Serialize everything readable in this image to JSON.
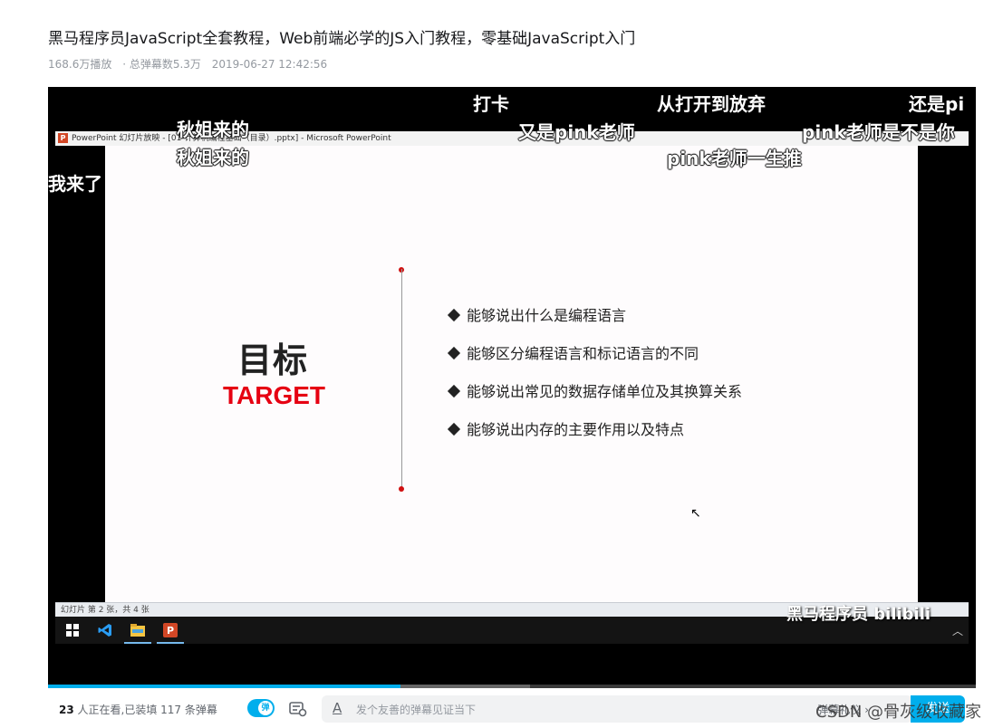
{
  "video": {
    "title": "黑马程序员JavaScript全套教程，Web前端必学的JS入门教程，零基础JavaScript入门",
    "plays": "168.6万播放",
    "danmaku_total": "· 总弹幕数5.3万",
    "date": "2019-06-27 12:42:56"
  },
  "ppt": {
    "window_title": "PowerPoint 幻灯片放映 - [01-计算机编程基础（目录）.pptx] - Microsoft PowerPoint",
    "app_icon": "P",
    "status": "幻灯片 第 2 张，共 4 张",
    "slide": {
      "heading": "目标",
      "subheading": "TARGET",
      "bullets": [
        "能够说出什么是编程语言",
        "能够区分编程语言和标记语言的不同",
        "能够说出常见的数据存储单位及其换算关系",
        "能够说出内存的主要作用以及特点"
      ]
    }
  },
  "danmaku": [
    "打卡",
    "从打开到放弃",
    "还是pi",
    "秋姐来的",
    "秋姐来的",
    "又是pink老师",
    "pink老师是不是你",
    "pink老师一生推",
    "我来了"
  ],
  "watermark": "黑马程序员 bilibili",
  "player": {
    "progress_fraction": 0.38,
    "buffer_fraction": 0.52,
    "watching_count": "23",
    "watching_text": " 人正在看,已装填 117 条弹幕",
    "toggle_label": "弹",
    "input_placeholder": "发个友善的弹幕见证当下",
    "etiquette": "弹幕礼仪 ›",
    "send": "发送"
  },
  "overlay": {
    "csdn": "CSDN @骨灰级收藏家"
  },
  "icons": {
    "windows": "windows-start-icon",
    "vscode": "vscode-icon",
    "explorer": "file-explorer-icon",
    "powerpoint": "powerpoint-icon"
  },
  "colors": {
    "accent": "#00aeec",
    "target_red": "#e60012"
  }
}
